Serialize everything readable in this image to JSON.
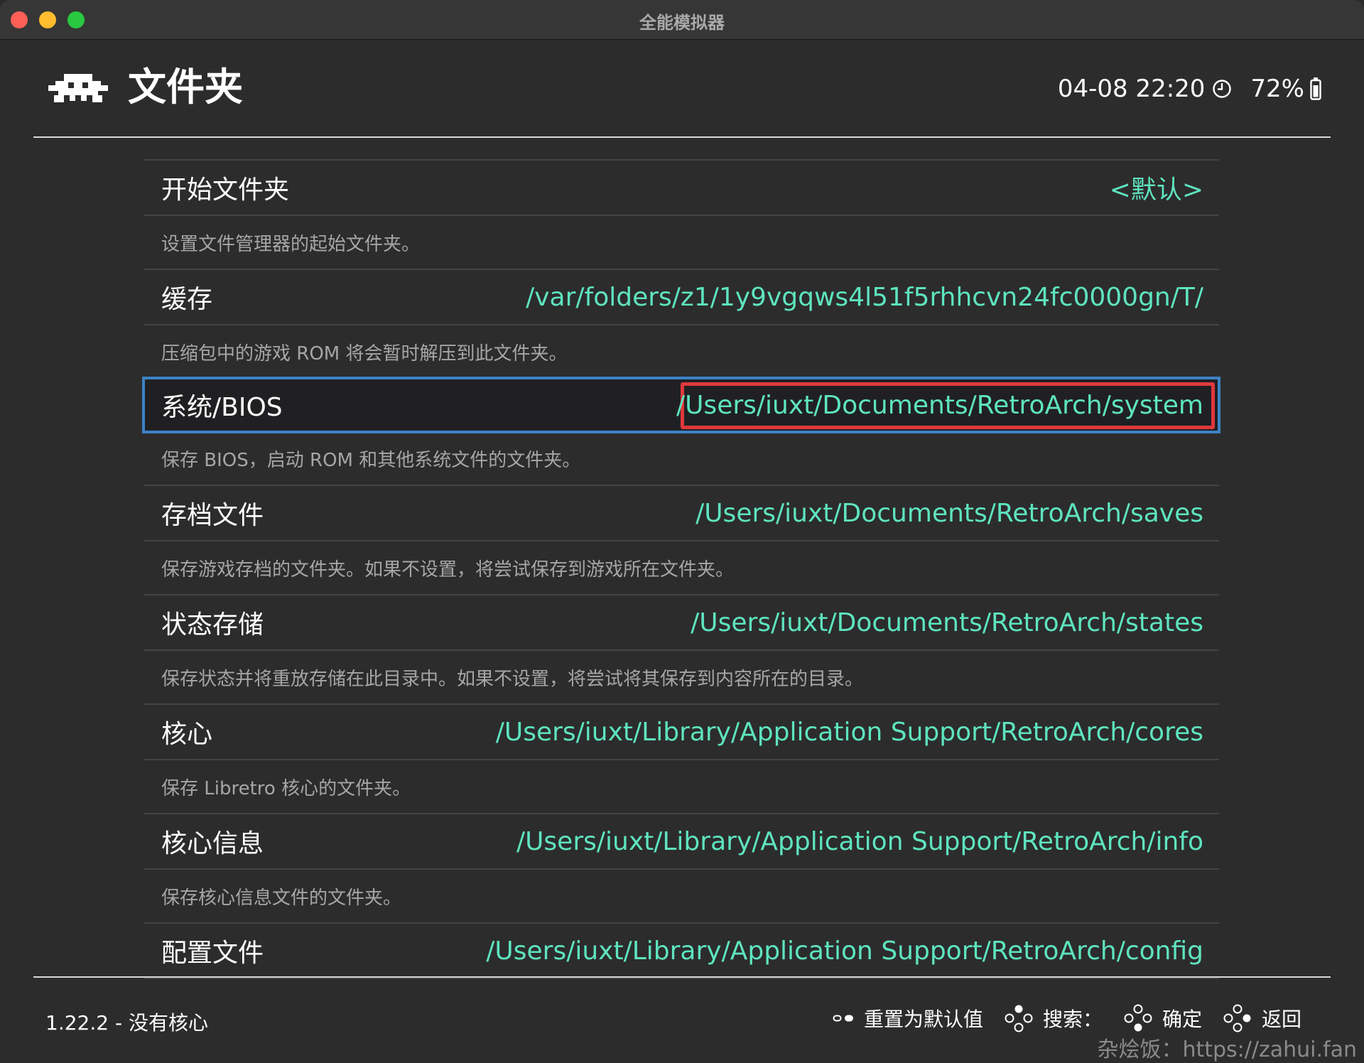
{
  "window": {
    "title": "全能模拟器"
  },
  "header": {
    "title": "文件夹",
    "datetime": "04-08 22:20",
    "battery": "72%"
  },
  "settings": [
    {
      "label": "开始文件夹",
      "value": "<默认>",
      "description": "设置文件管理器的起始文件夹。"
    },
    {
      "label": "缓存",
      "value": "/var/folders/z1/1y9vgqws4l51f5rhhcvn24fc0000gn/T/",
      "description": "压缩包中的游戏 ROM 将会暂时解压到此文件夹。"
    },
    {
      "label": "系统/BIOS",
      "value": "/Users/iuxt/Documents/RetroArch/system",
      "description": "保存 BIOS，启动 ROM 和其他系统文件的文件夹。"
    },
    {
      "label": "存档文件",
      "value": "/Users/iuxt/Documents/RetroArch/saves",
      "description": "保存游戏存档的文件夹。如果不设置，将尝试保存到游戏所在文件夹。"
    },
    {
      "label": "状态存储",
      "value": "/Users/iuxt/Documents/RetroArch/states",
      "description": "保存状态并将重放存储在此目录中。如果不设置，将尝试将其保存到内容所在的目录。"
    },
    {
      "label": "核心",
      "value": "/Users/iuxt/Library/Application Support/RetroArch/cores",
      "description": "保存 Libretro 核心的文件夹。"
    },
    {
      "label": "核心信息",
      "value": "/Users/iuxt/Library/Application Support/RetroArch/info",
      "description": "保存核心信息文件的文件夹。"
    },
    {
      "label": "配置文件",
      "value": "/Users/iuxt/Library/Application Support/RetroArch/config"
    }
  ],
  "footer": {
    "version": "1.22.2 - 没有核心",
    "reset": "重置为默认值",
    "search": "搜索：",
    "confirm": "确定",
    "back": "返回"
  },
  "watermark": "杂烩饭：https://zahui.fan",
  "colors": {
    "accent_value": "#5ee4be",
    "selection_outline": "#3d82c6",
    "highlight_box": "#e0383d"
  }
}
